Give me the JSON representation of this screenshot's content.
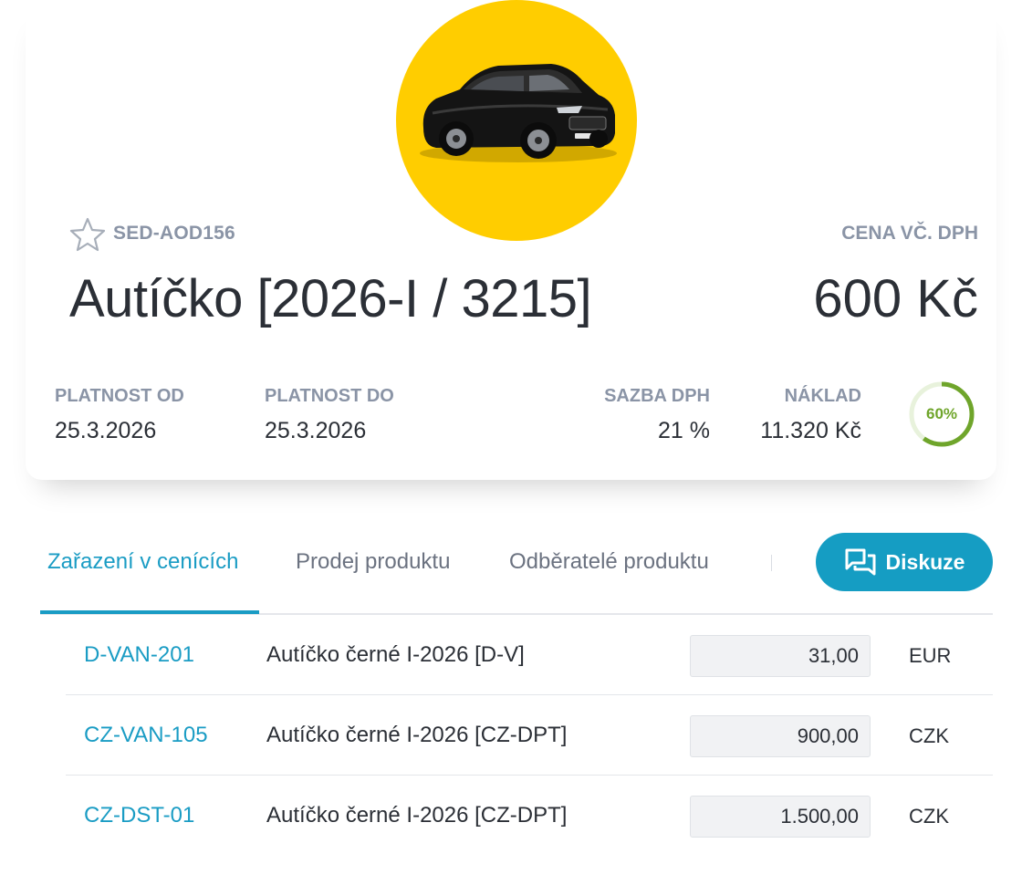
{
  "product": {
    "sku": "SED-AOD156",
    "title": "Autíčko [2026-I / 3215]",
    "price_label": "CENA VČ. DPH",
    "price": "600 Kč",
    "image_icon": "car-image",
    "favorite_icon": "star-outline-icon"
  },
  "meta": {
    "valid_from_label": "PLATNOST OD",
    "valid_from": "25.3.2026",
    "valid_to_label": "PLATNOST DO",
    "valid_to": "25.3.2026",
    "vat_label": "SAZBA DPH",
    "vat": "21 %",
    "cost_label": "NÁKLAD",
    "cost": "11.320 Kč",
    "margin_text": "60%",
    "margin_fraction": 0.6
  },
  "tabs": [
    {
      "label": "Zařazení v cenících",
      "active": true
    },
    {
      "label": "Prodej produktu",
      "active": false
    },
    {
      "label": "Odběratelé produktu",
      "active": false
    }
  ],
  "discuss_button": {
    "label": "Diskuze",
    "icon": "chat-bubbles-icon"
  },
  "price_lists": [
    {
      "code": "D-VAN-201",
      "name": "Autíčko černé I-2026 [D-V]",
      "value": "31,00",
      "currency": "EUR"
    },
    {
      "code": "CZ-VAN-105",
      "name": "Autíčko černé I-2026 [CZ-DPT]",
      "value": "900,00",
      "currency": "CZK"
    },
    {
      "code": "CZ-DST-01",
      "name": "Autíčko černé I-2026 [CZ-DPT]",
      "value": "1.500,00",
      "currency": "CZK"
    }
  ],
  "colors": {
    "accent": "#1a9cc4",
    "button": "#159dc3",
    "hero_bg": "#ffcd00",
    "ring_green": "#6fa52b"
  }
}
